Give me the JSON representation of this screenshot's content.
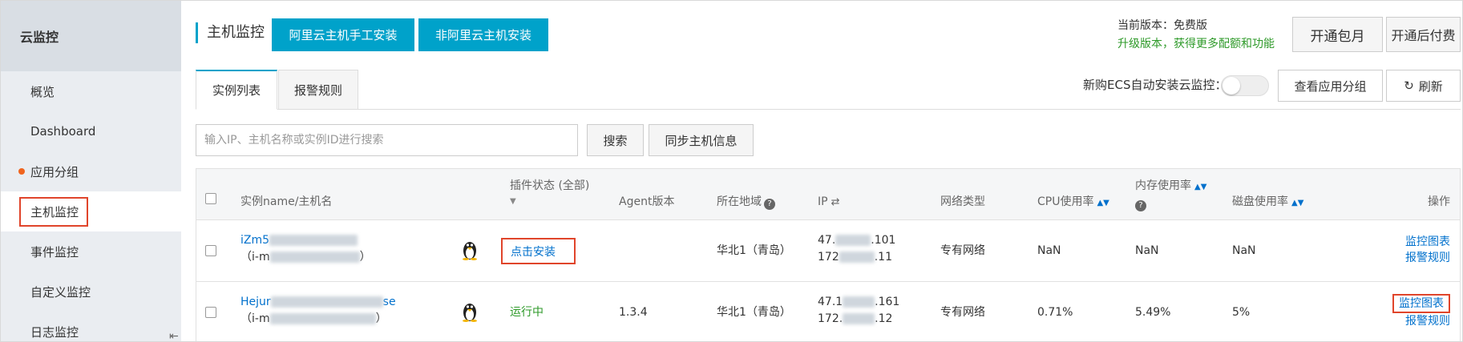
{
  "sidebar": {
    "title": "云监控",
    "items": [
      {
        "label": "概览"
      },
      {
        "label": "Dashboard"
      },
      {
        "label": "应用分组"
      },
      {
        "label": "主机监控"
      },
      {
        "label": "事件监控"
      },
      {
        "label": "自定义监控"
      },
      {
        "label": "日志监控"
      }
    ]
  },
  "header": {
    "title": "主机监控",
    "install_aliyun": "阿里云主机手工安装",
    "install_non_aliyun": "非阿里云主机安装",
    "version_label": "当前版本：免费版",
    "upgrade_text": "升级版本，获得更多配额和功能",
    "monthly_btn": "开通包月",
    "postpaid_btn": "开通后付费"
  },
  "tabs": [
    {
      "label": "实例列表",
      "active": true
    },
    {
      "label": "报警规则",
      "active": false
    }
  ],
  "toolbar": {
    "auto_install_label": "新购ECS自动安装云监控：",
    "view_group_btn": "查看应用分组",
    "refresh_btn": "刷新"
  },
  "search": {
    "placeholder": "输入IP、主机名称或实例ID进行搜索",
    "search_btn": "搜索",
    "sync_btn": "同步主机信息"
  },
  "table": {
    "headers": {
      "name": "实例name/主机名",
      "plugin": "插件状态 (全部)",
      "agent": "Agent版本",
      "region": "所在地域",
      "ip": "IP",
      "network": "网络类型",
      "cpu": "CPU使用率",
      "mem": "内存使用率",
      "disk": "磁盘使用率",
      "ops": "操作"
    },
    "rows": [
      {
        "name_prefix": "iZm5",
        "host_prefix": "（i-m",
        "host_suffix": "）",
        "status": "点击安装",
        "agent": "",
        "region": "华北1（青岛）",
        "ip1_prefix": "47.",
        "ip1_suffix": ".101",
        "ip2_prefix": "172",
        "ip2_suffix": ".11",
        "network": "专有网络",
        "cpu": "NaN",
        "mem": "NaN",
        "disk": "NaN",
        "op1": "监控图表",
        "op2": "报警规则"
      },
      {
        "name_prefix": "Hejur",
        "name_suffix": "se",
        "host_prefix": "（i-m",
        "host_suffix": "）",
        "status": "运行中",
        "agent": "1.3.4",
        "region": "华北1（青岛）",
        "ip1_prefix": "47.1",
        "ip1_suffix": ".161",
        "ip2_prefix": "172.",
        "ip2_suffix": ".12",
        "network": "专有网络",
        "cpu": "0.71%",
        "mem": "5.49%",
        "disk": "5%",
        "op1": "监控图表",
        "op2": "报警规则"
      }
    ]
  }
}
